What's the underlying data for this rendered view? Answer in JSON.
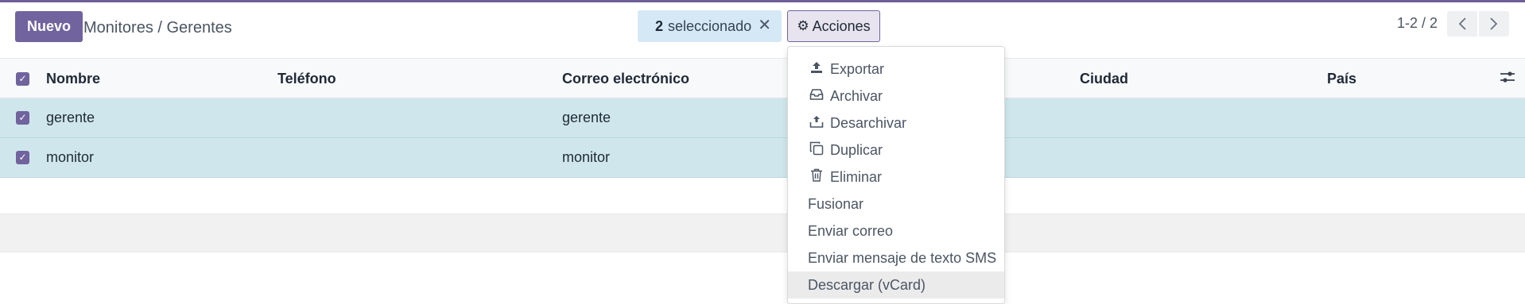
{
  "control_panel": {
    "new_label": "Nuevo",
    "breadcrumb": "Monitores / Gerentes",
    "selection": {
      "count": "2",
      "label": "seleccionado",
      "clear_icon": "close-icon"
    },
    "actions_label": "Acciones",
    "actions_icon": "gear-icon",
    "pager": {
      "value": "1-2 / 2",
      "prev_icon": "chevron-left-icon",
      "next_icon": "chevron-right-icon"
    }
  },
  "table": {
    "columns": [
      "Nombre",
      "Teléfono",
      "Correo electrónico",
      "Ciudad",
      "País"
    ],
    "rows": [
      {
        "selected": true,
        "name": "gerente",
        "phone": "",
        "email": "gerente",
        "city": "",
        "country": ""
      },
      {
        "selected": true,
        "name": "monitor",
        "phone": "",
        "email": "monitor",
        "city": "",
        "country": ""
      }
    ]
  },
  "actions_menu": {
    "items": [
      {
        "label": "Exportar",
        "icon": "upload-icon"
      },
      {
        "label": "Archivar",
        "icon": "inbox-icon"
      },
      {
        "label": "Desarchivar",
        "icon": "unarchive-icon"
      },
      {
        "label": "Duplicar",
        "icon": "copy-icon"
      },
      {
        "label": "Eliminar",
        "icon": "trash-icon"
      },
      {
        "label": "Fusionar",
        "icon": ""
      },
      {
        "label": "Enviar correo",
        "icon": ""
      },
      {
        "label": "Enviar mensaje de texto SMS",
        "icon": ""
      },
      {
        "label": "Descargar (vCard)",
        "icon": "",
        "highlighted": true
      }
    ]
  },
  "colors": {
    "accent": "#71639e",
    "selected_row": "#cfe7ec",
    "selection_pill": "#d5e8f5"
  }
}
